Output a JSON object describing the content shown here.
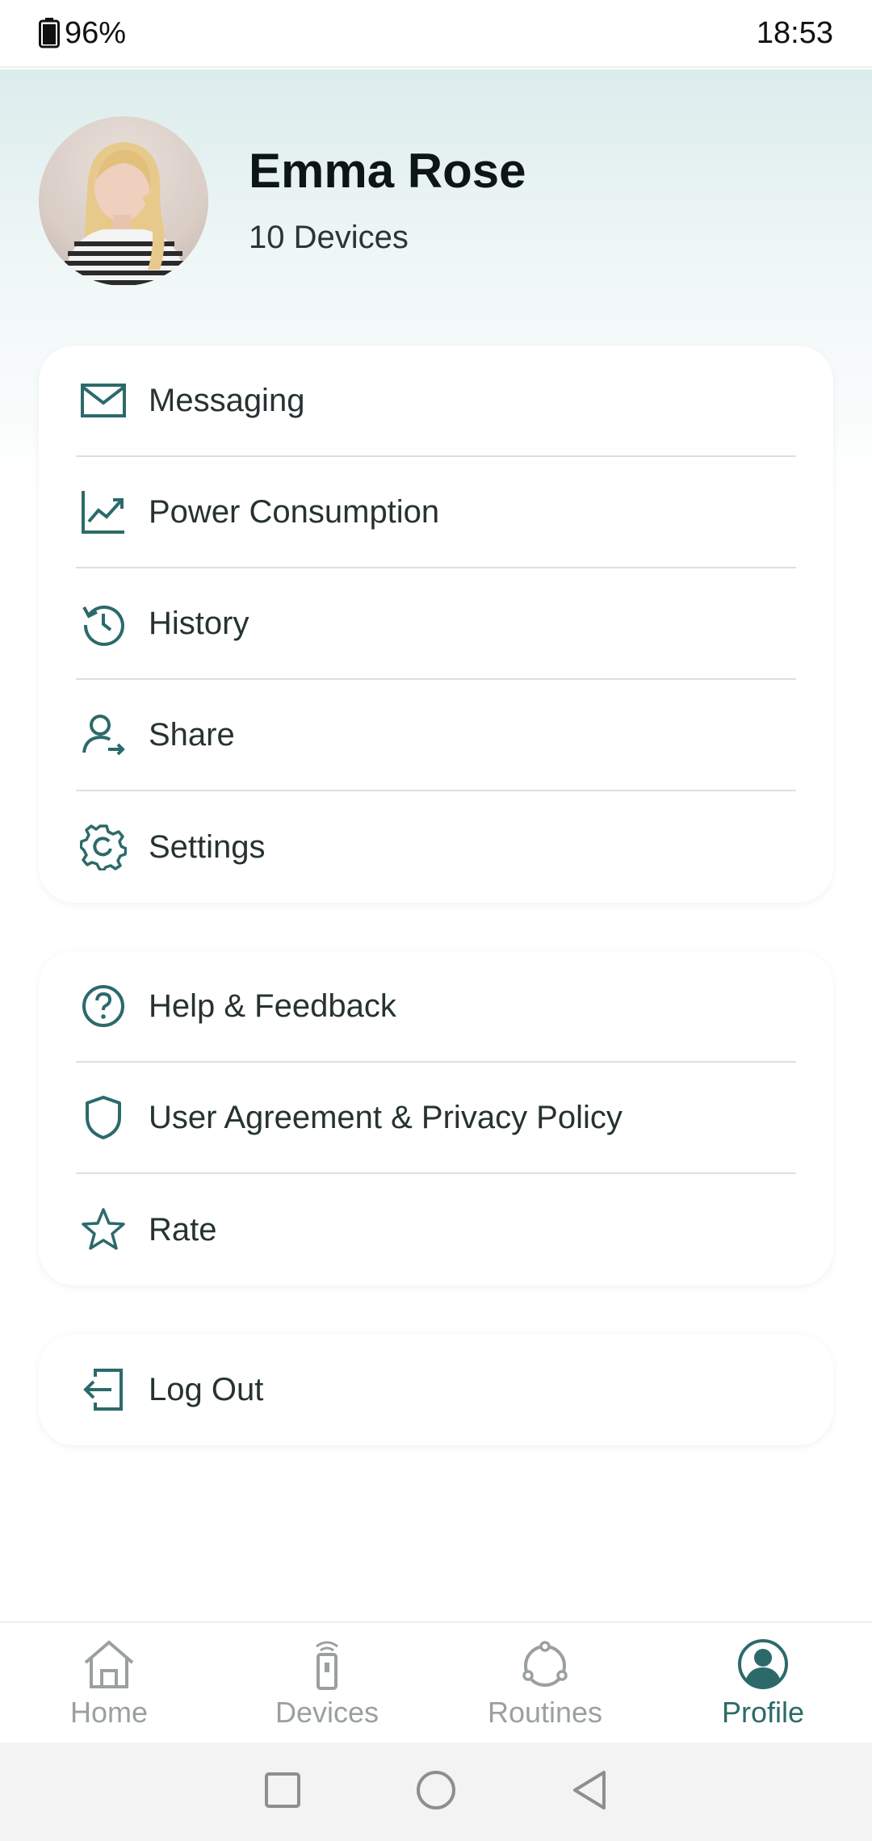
{
  "status_bar": {
    "battery": "96%",
    "time": "18:53"
  },
  "profile": {
    "name": "Emma Rose",
    "devices": "10 Devices"
  },
  "menu_primary": [
    {
      "label": "Messaging",
      "icon": "mail-icon"
    },
    {
      "label": "Power Consumption",
      "icon": "trend-chart-icon"
    },
    {
      "label": "History",
      "icon": "history-icon"
    },
    {
      "label": "Share",
      "icon": "share-user-icon"
    },
    {
      "label": "Settings",
      "icon": "gear-icon"
    }
  ],
  "menu_secondary": [
    {
      "label": "Help & Feedback",
      "icon": "help-icon"
    },
    {
      "label": "User Agreement & Privacy Policy",
      "icon": "shield-icon"
    },
    {
      "label": "Rate",
      "icon": "star-icon"
    }
  ],
  "menu_logout": [
    {
      "label": "Log Out",
      "icon": "logout-icon"
    }
  ],
  "bottom_nav": [
    {
      "label": "Home",
      "icon": "home-icon",
      "active": false
    },
    {
      "label": "Devices",
      "icon": "remote-icon",
      "active": false
    },
    {
      "label": "Routines",
      "icon": "routines-icon",
      "active": false
    },
    {
      "label": "Profile",
      "icon": "profile-icon",
      "active": true
    }
  ],
  "colors": {
    "accent": "#2c6a6a",
    "inactive": "#9aa0a0",
    "header_tint": "#dcecec"
  }
}
